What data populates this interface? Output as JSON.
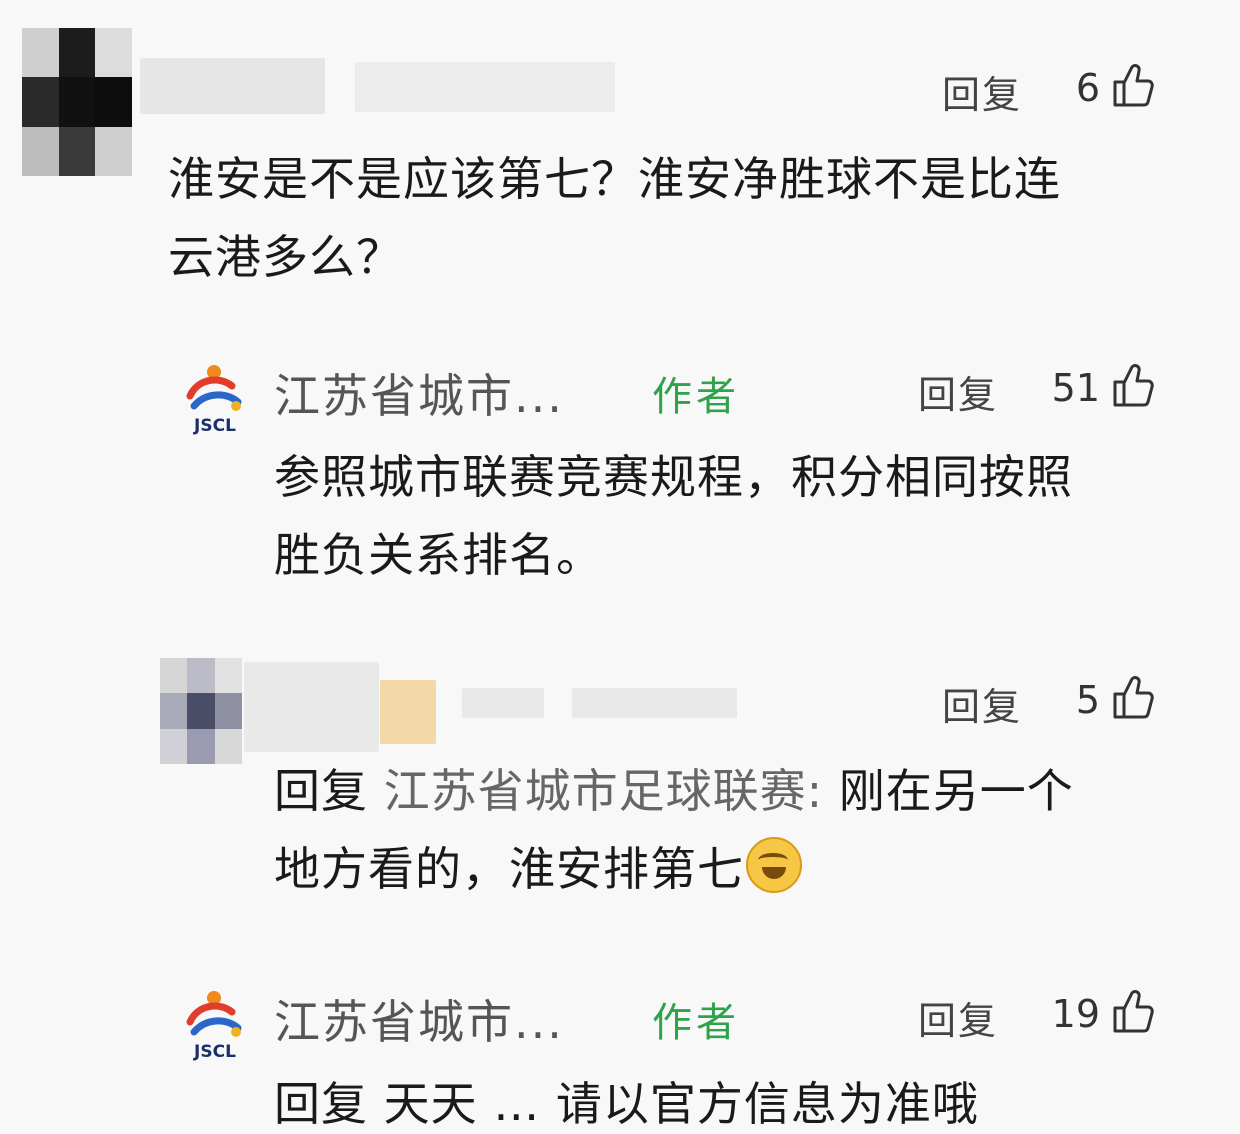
{
  "comments": [
    {
      "reply_label": "回复",
      "likes": "6",
      "text_line1": "淮安是不是应该第七？淮安净胜球不是比连",
      "text_line2": "云港多么？"
    },
    {
      "author": "江苏省城市...",
      "author_tag": "作者",
      "logo_text": "JSCL",
      "reply_label": "回复",
      "likes": "51",
      "text_line1": "参照城市联赛竞赛规程，积分相同按照",
      "text_line2": "胜负关系排名。"
    },
    {
      "reply_label": "回复",
      "likes": "5",
      "reply_prefix": "回复",
      "reply_target": "江苏省城市足球联赛:",
      "text_line1_rest": "刚在另一个",
      "text_line2": "地方看的，淮安排第七",
      "emoji": "laughing-crying-emoji"
    },
    {
      "author": "江苏省城市...",
      "author_tag": "作者",
      "logo_text": "JSCL",
      "reply_label": "回复",
      "likes": "19",
      "text_partial": "回复 天天 … 请以官方信息为准哦"
    }
  ],
  "colors": {
    "author_tag": "#2fa34a",
    "background": "#f8f8f8",
    "text": "#1a1a1a"
  }
}
